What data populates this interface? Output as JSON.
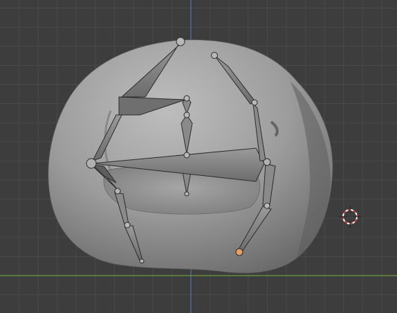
{
  "viewport": {
    "background": "#3d3d3d",
    "grid_color": "#4a4a4a",
    "x_axis_color": "#6e9a3a",
    "z_axis_color": "#4f7fc2",
    "view": "front-orthographic"
  },
  "scene": {
    "mesh": {
      "name_semantic": "blob-mesh",
      "shading": "solid",
      "color": "#9a9a9a"
    },
    "armature": {
      "bone_color": "#8e8e8e",
      "bone_outline": "#2a2a2a",
      "bone_count": 12,
      "selected_joint": "right-leg-tip",
      "selected_color": "#e8a060"
    },
    "cursor_3d": {
      "icon": "3d-cursor-icon",
      "ring_colors": [
        "#ffffff",
        "#d03a3a"
      ]
    }
  }
}
